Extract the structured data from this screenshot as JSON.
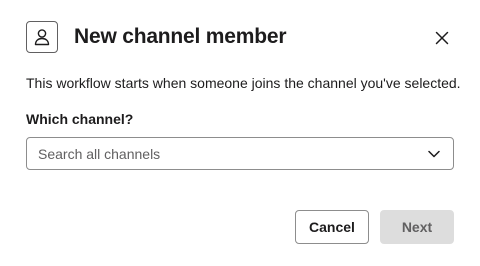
{
  "dialog": {
    "title": "New channel member",
    "header_icon": "person-icon",
    "close_icon": "close-icon",
    "description": "This workflow starts when someone joins the channel you've selected.",
    "channel_field": {
      "label": "Which channel?",
      "placeholder": "Search all channels",
      "icon": "chevron-down-icon"
    },
    "buttons": {
      "cancel_label": "Cancel",
      "next_label": "Next",
      "next_enabled": false
    }
  },
  "colors": {
    "text": "#1d1c1d",
    "muted_text": "#616061",
    "border": "#8d8d8d",
    "disabled_button_bg": "#dddddd"
  }
}
